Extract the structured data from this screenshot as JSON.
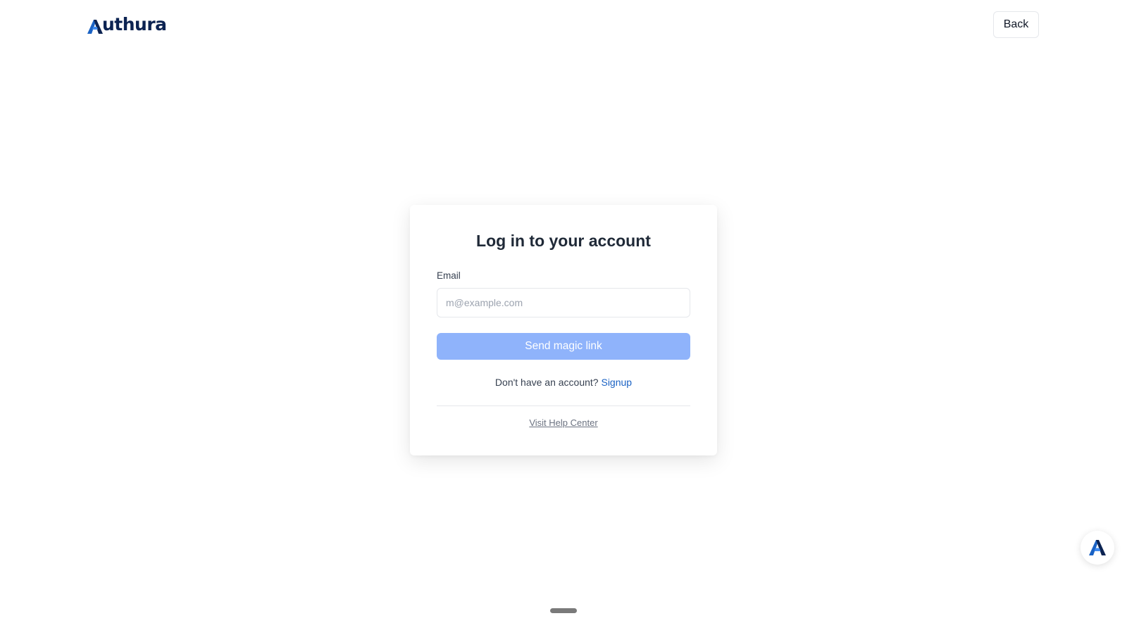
{
  "header": {
    "logo_text": "uthura",
    "logo_letter": "A",
    "back_label": "Back"
  },
  "login": {
    "title": "Log in to your account",
    "email_label": "Email",
    "email_placeholder": "m@example.com",
    "email_value": "",
    "submit_label": "Send magic link",
    "signup_prompt": "Don't have an account?",
    "signup_label": "Signup",
    "help_label": "Visit Help Center"
  },
  "colors": {
    "brand_dark": "#0c2352",
    "brand_blue": "#1a62c4",
    "button_disabled": "#8fb3fb"
  },
  "icons": {
    "logo": "authura-logo-icon",
    "widget": "authura-widget-icon"
  }
}
